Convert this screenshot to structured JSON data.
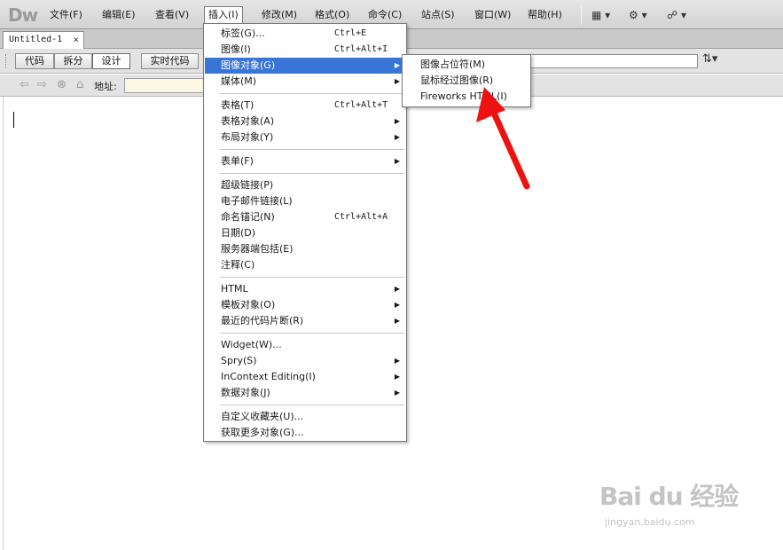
{
  "app": {
    "logo": "Dw"
  },
  "menubar": {
    "items": [
      {
        "label": "文件(F)"
      },
      {
        "label": "编辑(E)"
      },
      {
        "label": "查看(V)"
      },
      {
        "label": "插入(I)"
      },
      {
        "label": "修改(M)"
      },
      {
        "label": "格式(O)"
      },
      {
        "label": "命令(C)"
      },
      {
        "label": "站点(S)"
      },
      {
        "label": "窗口(W)"
      },
      {
        "label": "帮助(H)"
      }
    ],
    "tools": [
      "layout-icon ▾",
      "gear-icon ▾",
      "site-icon ▾"
    ]
  },
  "tabs": {
    "doc_title": "Untitled-1",
    "close": "×"
  },
  "viewbar": {
    "code": "代码",
    "split": "拆分",
    "design": "设计",
    "live_code": "实时代码"
  },
  "addressbar": {
    "label": "地址:",
    "value": ""
  },
  "insert_menu": {
    "items": [
      {
        "label": "标签(G)...",
        "shortcut": "Ctrl+E"
      },
      {
        "label": "图像(I)",
        "shortcut": "Ctrl+Alt+I"
      },
      {
        "label": "图像对象(G)",
        "shortcut": "",
        "submenu": true
      },
      {
        "label": "媒体(M)",
        "shortcut": "",
        "submenu": true
      },
      {
        "label": "表格(T)",
        "shortcut": "Ctrl+Alt+T"
      },
      {
        "label": "表格对象(A)",
        "shortcut": "",
        "submenu": true
      },
      {
        "label": "布局对象(Y)",
        "shortcut": "",
        "submenu": true
      },
      {
        "label": "表单(F)",
        "shortcut": "",
        "submenu": true
      },
      {
        "label": "超级链接(P)",
        "shortcut": ""
      },
      {
        "label": "电子邮件链接(L)",
        "shortcut": ""
      },
      {
        "label": "命名锚记(N)",
        "shortcut": "Ctrl+Alt+A"
      },
      {
        "label": "日期(D)",
        "shortcut": ""
      },
      {
        "label": "服务器端包括(E)",
        "shortcut": ""
      },
      {
        "label": "注释(C)",
        "shortcut": ""
      },
      {
        "label": "HTML",
        "shortcut": "",
        "submenu": true
      },
      {
        "label": "模板对象(O)",
        "shortcut": "",
        "submenu": true
      },
      {
        "label": "最近的代码片断(R)",
        "shortcut": "",
        "submenu": true
      },
      {
        "label": "Widget(W)...",
        "shortcut": ""
      },
      {
        "label": "Spry(S)",
        "shortcut": "",
        "submenu": true
      },
      {
        "label": "InContext Editing(I)",
        "shortcut": "",
        "submenu": true
      },
      {
        "label": "数据对象(J)",
        "shortcut": "",
        "submenu": true
      },
      {
        "label": "自定义收藏夹(U)...",
        "shortcut": ""
      },
      {
        "label": "获取更多对象(G)...",
        "shortcut": ""
      }
    ]
  },
  "image_objects_submenu": {
    "items": [
      "图像占位符(M)",
      "鼠标经过图像(R)",
      "Fireworks HTML(I)"
    ]
  },
  "watermark": {
    "brand": "Bai du 经验",
    "url": "jingyan.baidu.com"
  },
  "colors": {
    "highlight": "#3875d7",
    "arrow": "#ee1111"
  }
}
